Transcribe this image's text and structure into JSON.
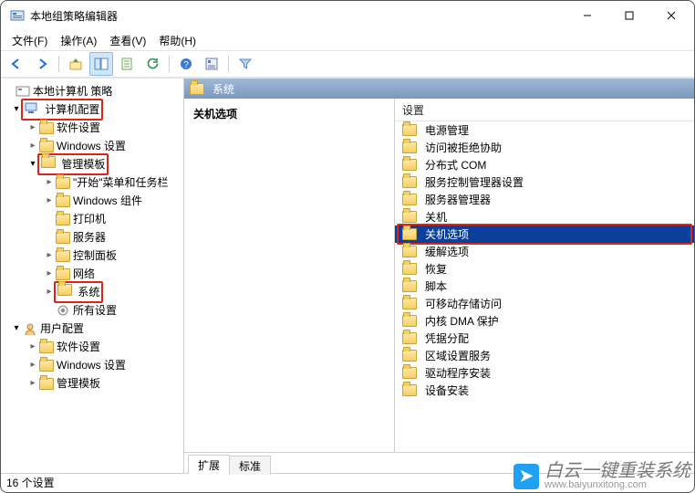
{
  "window": {
    "title": "本地组策略编辑器"
  },
  "menu": {
    "file": "文件(F)",
    "action": "操作(A)",
    "view": "查看(V)",
    "help": "帮助(H)"
  },
  "toolbar": {
    "back": "back-icon",
    "forward": "forward-icon",
    "up": "up-icon",
    "showhide": "showhide-icon",
    "export": "export-icon",
    "refresh": "refresh-icon",
    "help": "help-icon",
    "props": "properties-icon",
    "filter": "filter-icon"
  },
  "tree": {
    "root": "本地计算机 策略",
    "computer": "计算机配置",
    "software1": "软件设置",
    "windows1": "Windows 设置",
    "admintpl": "管理模板",
    "startmenu": "\"开始\"菜单和任务栏",
    "wincomp": "Windows 组件",
    "printer": "打印机",
    "server": "服务器",
    "ctrlpanel": "控制面板",
    "network": "网络",
    "system": "系统",
    "allsettings": "所有设置",
    "user": "用户配置",
    "software2": "软件设置",
    "windows2": "Windows 设置",
    "admintpl2": "管理模板"
  },
  "right": {
    "header_label": "系统",
    "left_title": "关机选项",
    "list_header": "设置",
    "items": [
      "电源管理",
      "访问被拒绝协助",
      "分布式 COM",
      "服务控制管理器设置",
      "服务器管理器",
      "关机",
      "关机选项",
      "缓解选项",
      "恢复",
      "脚本",
      "可移动存储访问",
      "内核 DMA 保护",
      "凭据分配",
      "区域设置服务",
      "驱动程序安装",
      "设备安装"
    ],
    "selected_index": 6
  },
  "tabs": {
    "extended": "扩展",
    "standard": "标准"
  },
  "status": "16 个设置",
  "watermark": {
    "brand": "白云一键重装系统",
    "url": "www.baiyunxitong.com"
  }
}
